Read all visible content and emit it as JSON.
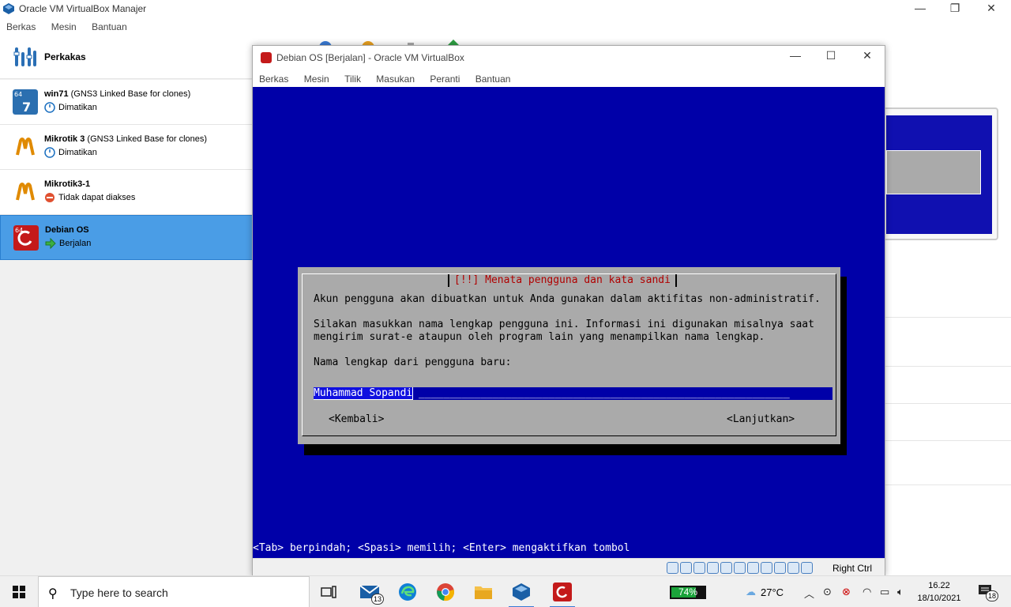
{
  "manager": {
    "title": "Oracle VM VirtualBox Manajer",
    "menu": [
      "Berkas",
      "Mesin",
      "Bantuan"
    ],
    "tools_label": "Perkakas",
    "vms": [
      {
        "name": "win71",
        "group": "(GNS3 Linked Base for clones)",
        "state": "Dimatikan",
        "state_kind": "off"
      },
      {
        "name": "Mikrotik 3",
        "group": "(GNS3 Linked Base for clones)",
        "state": "Dimatikan",
        "state_kind": "off"
      },
      {
        "name": "Mikrotik3-1",
        "group": "",
        "state": "Tidak dapat diakses",
        "state_kind": "error"
      },
      {
        "name": "Debian OS",
        "group": "",
        "state": "Berjalan",
        "state_kind": "running"
      }
    ],
    "selected_vm": "Debian OS"
  },
  "vm_window": {
    "title": "Debian OS [Berjalan] - Oracle VM VirtualBox",
    "menu": [
      "Berkas",
      "Mesin",
      "Tilik",
      "Masukan",
      "Peranti",
      "Bantuan"
    ],
    "host_key": "Right Ctrl"
  },
  "installer": {
    "dialog_title": "[!!] Menata pengguna dan kata sandi",
    "line1": "Akun pengguna akan dibuatkan untuk Anda gunakan dalam aktifitas non-administratif.",
    "line2": "Silakan masukkan nama lengkap pengguna ini. Informasi ini digunakan misalnya saat",
    "line3": "mengirim surat-e ataupun oleh program lain yang menampilkan nama lengkap.",
    "prompt": "Nama lengkap dari pengguna baru:",
    "field_value": "Muhammad Sopandi",
    "back_button": "<Kembali>",
    "continue_button": "<Lanjutkan>",
    "hint": "<Tab> berpindah; <Spasi> memilih; <Enter> mengaktifkan tombol"
  },
  "taskbar": {
    "search_placeholder": "Type here to search",
    "mail_badge": "13",
    "battery_percent": "74%",
    "battery_level": 0.74,
    "temperature": "27°C",
    "time": "16.22",
    "date": "18/10/2021",
    "notifications": "18"
  },
  "colors": {
    "installer_bg": "#0000a8",
    "dialog_bg": "#aaaaaa",
    "dialog_title": "#b00000",
    "selection": "#4a9de6"
  }
}
